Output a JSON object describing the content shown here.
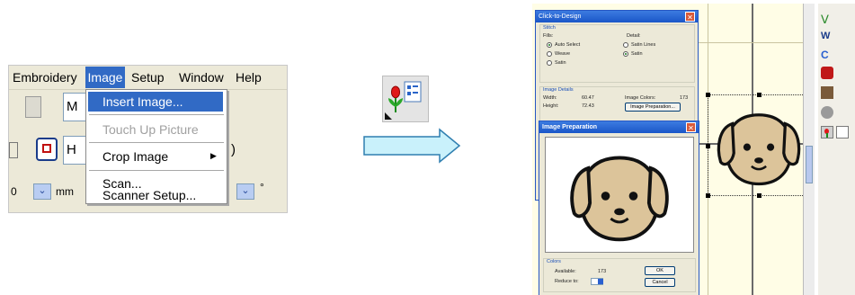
{
  "menu_screenshot": {
    "menubar": [
      "Embroidery",
      "Image",
      "Setup",
      "Window",
      "Help"
    ],
    "row1_field": "M",
    "row2_field": "H",
    "row2_suffix": ")",
    "row3_value": "0",
    "row3_unit": "mm",
    "row3_degree": "°",
    "dropdown_items": [
      "Insert Image...",
      "Touch Up Picture",
      "Crop Image",
      "Scan...",
      "Scanner Setup..."
    ]
  },
  "click_to_design": {
    "title": "Click-to-Design",
    "stitch_group": "Stitch",
    "fills_label": "Fills:",
    "detail_label": "Detail:",
    "fills": [
      "Auto Select",
      "Weave",
      "Satin"
    ],
    "details": [
      "Satin Lines",
      "Satin"
    ],
    "image_details_group": "Image Details",
    "width_label": "Width:",
    "width_value": "60.47",
    "height_label": "Height:",
    "height_value": "72.43",
    "image_colors_label": "Image Colors:",
    "image_colors_value": "173",
    "image_prep_button": "Image Preparation..."
  },
  "image_preparation": {
    "title": "Image Preparation",
    "colors_group": "Colors",
    "available_label": "Available:",
    "available_value": "173",
    "reduce_label": "Reduce to:",
    "ok": "OK",
    "cancel": "Cancel"
  },
  "colors": {
    "menu_highlight": "#316ac5",
    "xp_title": "#2a60d0",
    "arrow_fill": "#c9f1fb",
    "arrow_stroke": "#2f7fb0",
    "dog_fill": "#dcc49a",
    "canvas": "#fffde6"
  }
}
